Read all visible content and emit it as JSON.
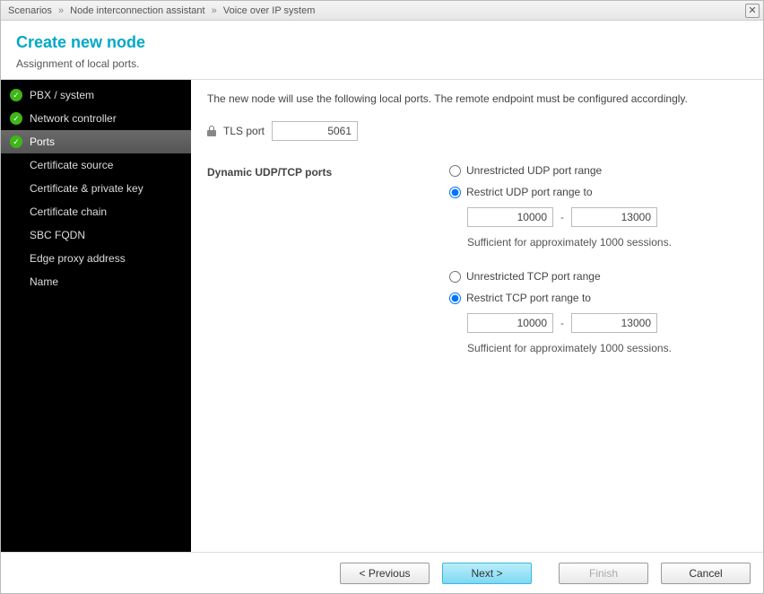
{
  "breadcrumb": {
    "a": "Scenarios",
    "b": "Node interconnection assistant",
    "c": "Voice over IP system"
  },
  "header": {
    "title": "Create new node",
    "subtitle": "Assignment of local ports."
  },
  "sidebar": {
    "items": [
      {
        "label": "PBX / system",
        "state": "done"
      },
      {
        "label": "Network controller",
        "state": "done"
      },
      {
        "label": "Ports",
        "state": "done",
        "current": true
      },
      {
        "label": "Certificate source",
        "state": "pending"
      },
      {
        "label": "Certificate & private key",
        "state": "pending"
      },
      {
        "label": "Certificate chain",
        "state": "pending"
      },
      {
        "label": "SBC FQDN",
        "state": "pending"
      },
      {
        "label": "Edge proxy address",
        "state": "pending"
      },
      {
        "label": "Name",
        "state": "pending"
      }
    ]
  },
  "main": {
    "intro": "The new node will use the following local ports. The remote endpoint must be configured accordingly.",
    "tls_label": "TLS port",
    "tls_value": "5061",
    "dyn_label": "Dynamic UDP/TCP ports",
    "udp": {
      "opt_unrestricted": "Unrestricted UDP port range",
      "opt_restrict": "Restrict UDP port range to",
      "from": "10000",
      "to": "13000",
      "hint": "Sufficient for approximately 1000 sessions."
    },
    "tcp": {
      "opt_unrestricted": "Unrestricted TCP port range",
      "opt_restrict": "Restrict TCP port range to",
      "from": "10000",
      "to": "13000",
      "hint": "Sufficient for approximately 1000 sessions."
    }
  },
  "footer": {
    "prev": "< Previous",
    "next": "Next >",
    "finish": "Finish",
    "cancel": "Cancel"
  }
}
